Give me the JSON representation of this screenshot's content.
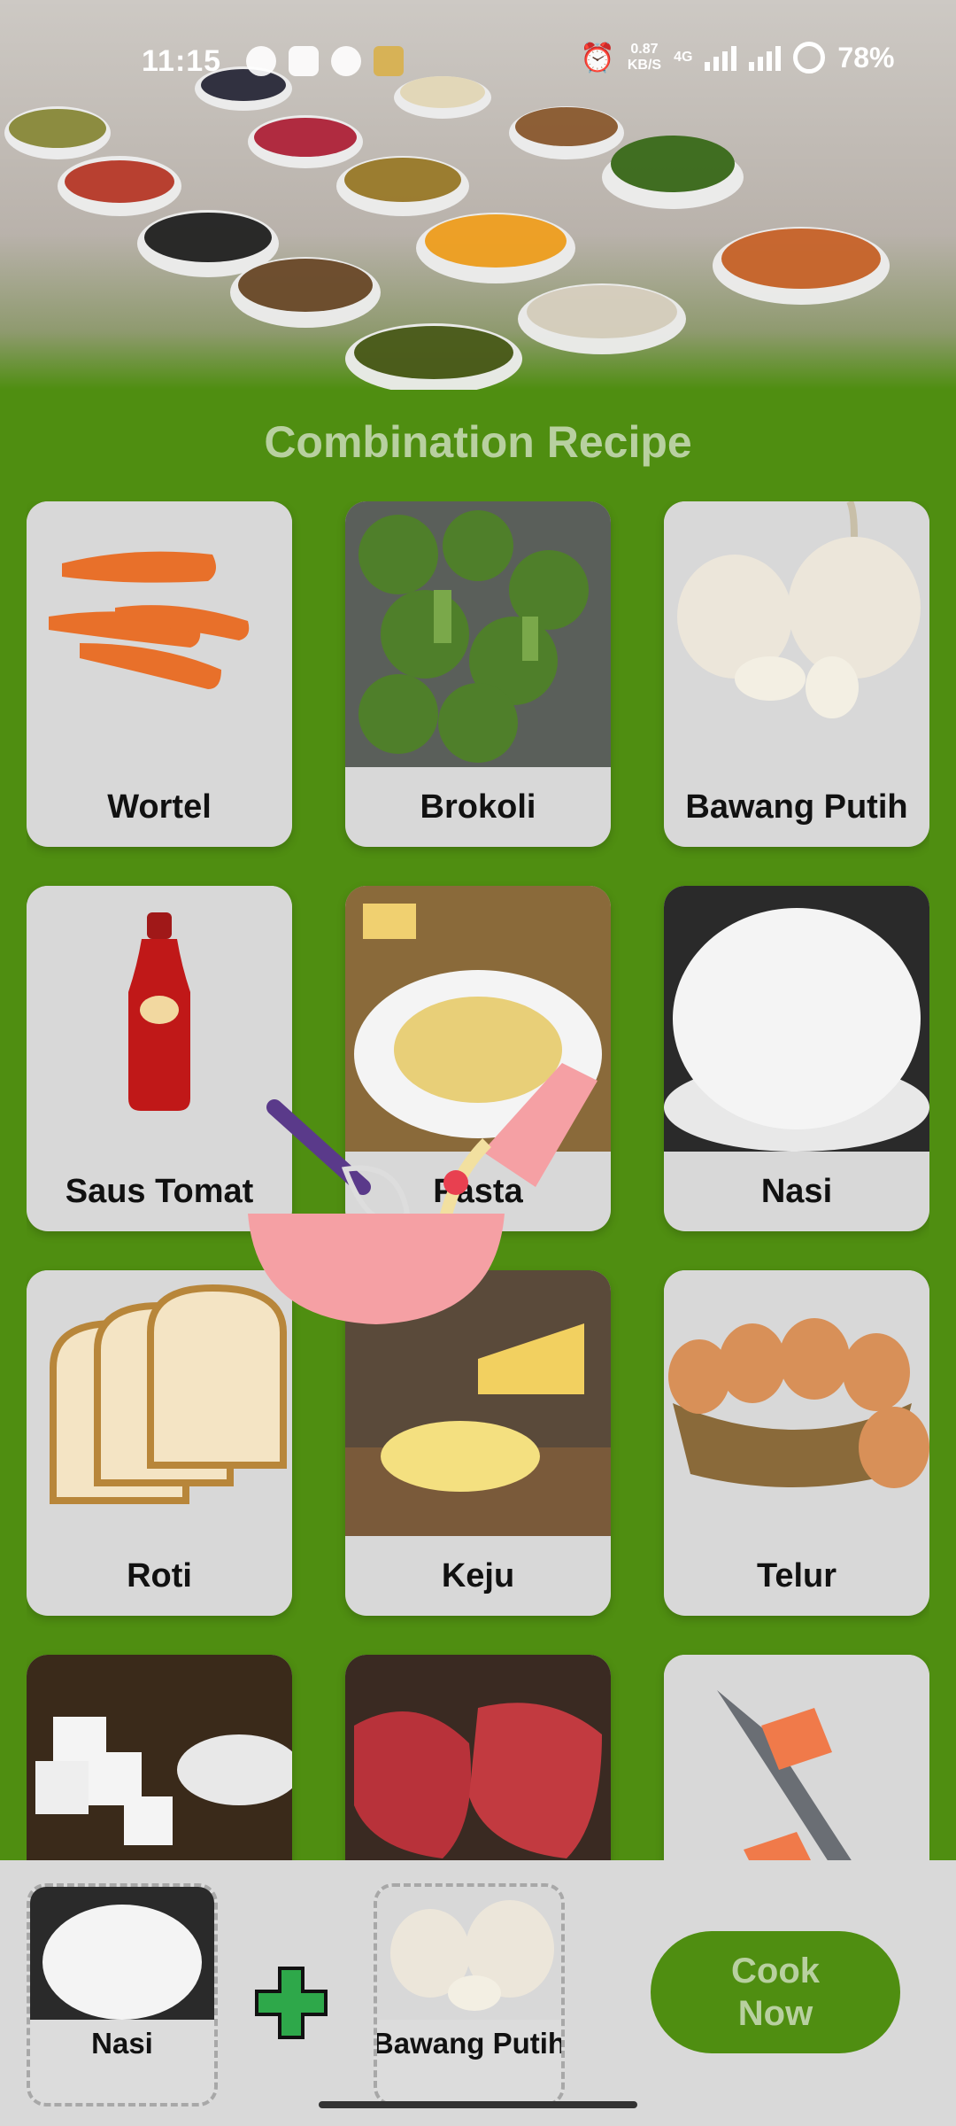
{
  "status_bar": {
    "time": "11:15",
    "network_speed": "0.87",
    "network_unit": "KB/S",
    "network_type": "4G",
    "battery": "78%"
  },
  "page": {
    "title": "Combination Recipe"
  },
  "ingredients": [
    {
      "label": "Wortel",
      "icon": "carrot-image"
    },
    {
      "label": "Brokoli",
      "icon": "broccoli-image"
    },
    {
      "label": "Bawang Putih",
      "icon": "garlic-image"
    },
    {
      "label": "Saus Tomat",
      "icon": "ketchup-image"
    },
    {
      "label": "Pasta",
      "icon": "pasta-image"
    },
    {
      "label": "Nasi",
      "icon": "rice-image"
    },
    {
      "label": "Roti",
      "icon": "bread-image"
    },
    {
      "label": "Keju",
      "icon": "cheese-image"
    },
    {
      "label": "Telur",
      "icon": "egg-image"
    },
    {
      "label": "",
      "icon": "sugar-image"
    },
    {
      "label": "",
      "icon": "meat-image"
    },
    {
      "label": "",
      "icon": "fish-image"
    }
  ],
  "combination": {
    "slot1_label": "Nasi",
    "slot2_label": "Bawang Putih",
    "cook_button": "Cook\nNow"
  },
  "colors": {
    "accent_green": "#4f8e11",
    "muted_green_text": "#b8d0a0",
    "plus_green": "#2ea84a"
  }
}
